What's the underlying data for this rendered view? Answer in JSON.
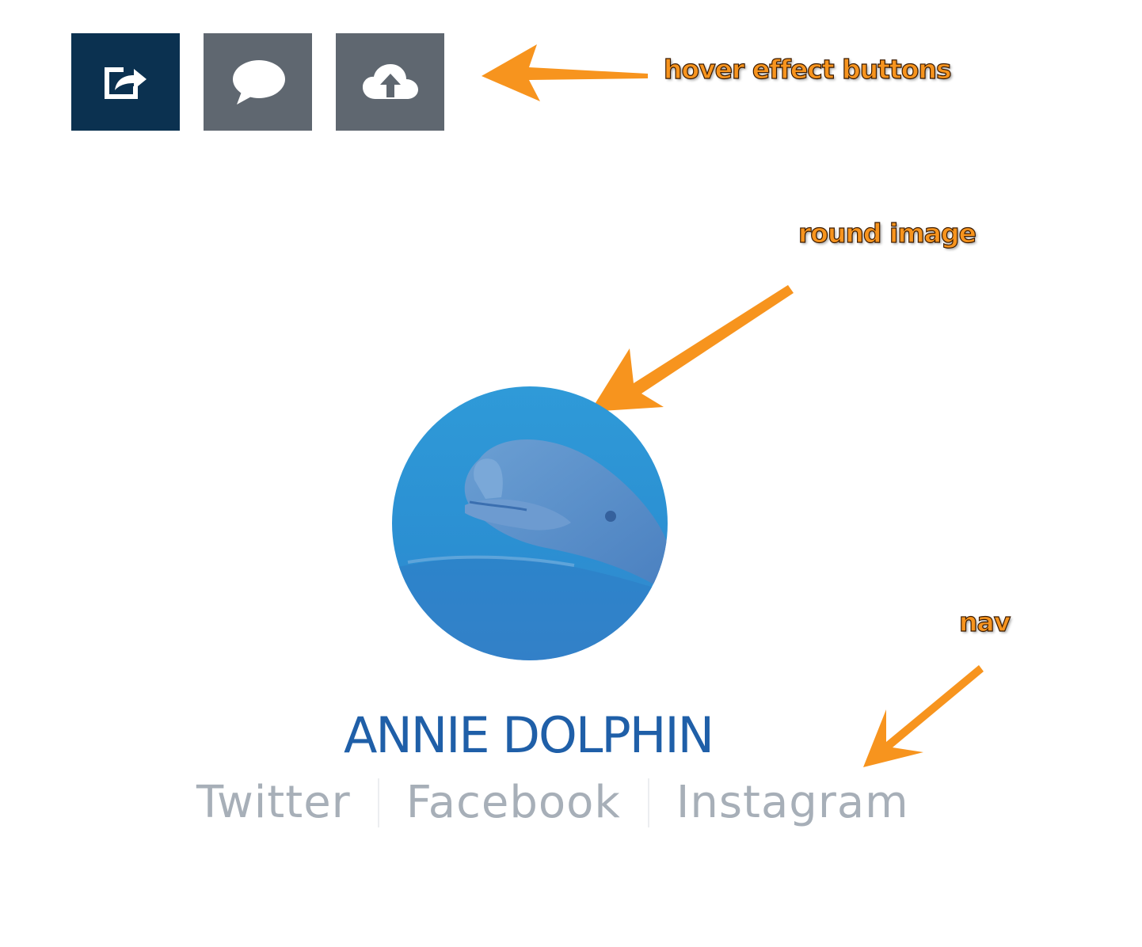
{
  "colors": {
    "active_button": "#0b3150",
    "inactive_button": "#5f6770",
    "icon": "#ffffff",
    "callout_text": "#f7941e",
    "arrow": "#f7941e",
    "name_text": "#1f5fa8",
    "nav_text": "#a7afb8",
    "avatar_bg": "#2d95d6"
  },
  "buttons": [
    {
      "icon": "share-icon",
      "state": "active"
    },
    {
      "icon": "comment-icon",
      "state": "default"
    },
    {
      "icon": "cloud-upload-icon",
      "state": "default"
    }
  ],
  "callouts": {
    "hover": "hover effect buttons",
    "round": "round image",
    "nav": "nav"
  },
  "profile": {
    "name": "ANNIE DOLPHIN",
    "image_subject": "dolphin"
  },
  "nav": {
    "items": [
      "Twitter",
      "Facebook",
      "Instagram"
    ]
  }
}
